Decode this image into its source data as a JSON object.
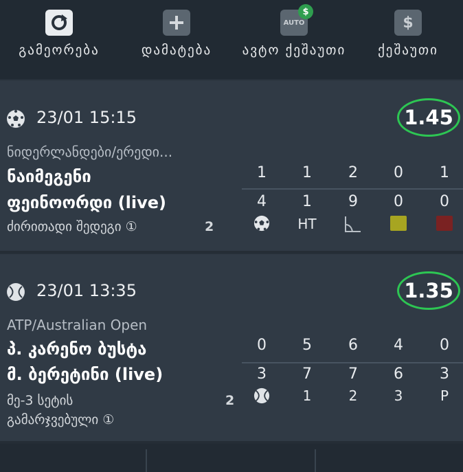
{
  "toolbar": {
    "items": [
      {
        "label": "გამეორება",
        "icon": "repeat-icon"
      },
      {
        "label": "დამატება",
        "icon": "plus-icon"
      },
      {
        "label": "ავტო ქეშაუთი",
        "icon": "auto-cashout-icon",
        "icon_text": "AUTO",
        "badge": "$"
      },
      {
        "label": "ქეშაუთი",
        "icon": "dollar-icon",
        "icon_text": "$"
      }
    ]
  },
  "events": [
    {
      "sport_icon": "soccer-ball-icon",
      "datetime": "23/01 15:15",
      "odds": "1.45",
      "league": "ნიდერლანდები/ერედი...",
      "team1": "ნაიმეგენი",
      "team2": "ფეინოორდი (live)",
      "market": "ძირითადი შედეგი ①",
      "market_count": "2",
      "scores_top": [
        "1",
        "1",
        "2",
        "0",
        "1"
      ],
      "scores_bottom": [
        "4",
        "1",
        "9",
        "0",
        "0"
      ],
      "legend": [
        "soccer-ball-icon",
        "HT",
        "corner-flag-icon",
        "yellow-card-icon",
        "red-card-icon"
      ],
      "colors": {
        "yellow_card": "#a7a521",
        "red_card": "#7a2222"
      }
    },
    {
      "sport_icon": "tennis-ball-icon",
      "datetime": "23/01 13:35",
      "odds": "1.35",
      "league": "ATP/Australian Open",
      "team1": "პ. კარენო ბუსტა",
      "team2": "მ. ბერეტინი (live)",
      "market_line1": "მე-3 სეტის",
      "market_line2": "გამარჯვებული ①",
      "market_count": "2",
      "scores_top": [
        "0",
        "5",
        "6",
        "4",
        "0"
      ],
      "scores_bottom": [
        "3",
        "7",
        "7",
        "6",
        "3"
      ],
      "legend": [
        "tennis-ball-icon",
        "1",
        "2",
        "3",
        "P"
      ]
    }
  ],
  "colors": {
    "accent_green": "#2dc653"
  }
}
